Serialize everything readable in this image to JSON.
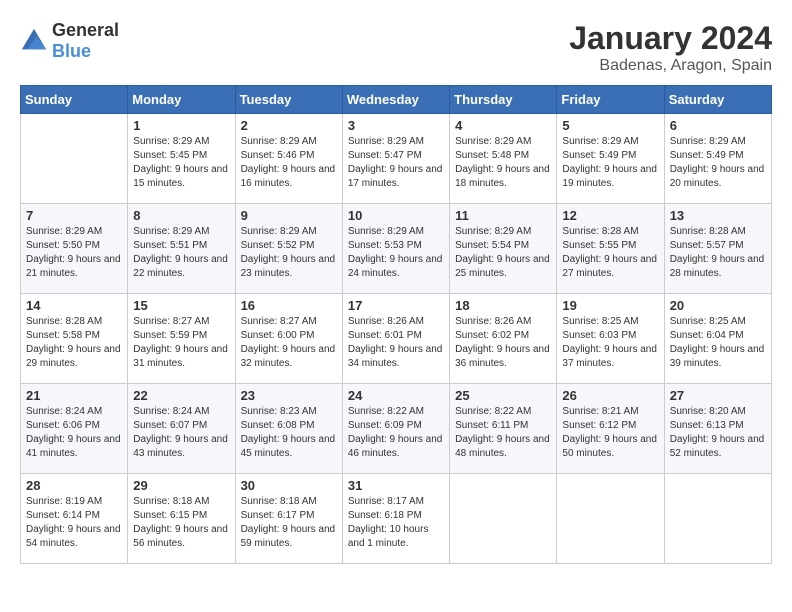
{
  "logo": {
    "general": "General",
    "blue": "Blue"
  },
  "title": "January 2024",
  "location": "Badenas, Aragon, Spain",
  "days_of_week": [
    "Sunday",
    "Monday",
    "Tuesday",
    "Wednesday",
    "Thursday",
    "Friday",
    "Saturday"
  ],
  "weeks": [
    [
      {
        "day": "",
        "sunrise": "",
        "sunset": "",
        "daylight": ""
      },
      {
        "day": "1",
        "sunrise": "Sunrise: 8:29 AM",
        "sunset": "Sunset: 5:45 PM",
        "daylight": "Daylight: 9 hours and 15 minutes."
      },
      {
        "day": "2",
        "sunrise": "Sunrise: 8:29 AM",
        "sunset": "Sunset: 5:46 PM",
        "daylight": "Daylight: 9 hours and 16 minutes."
      },
      {
        "day": "3",
        "sunrise": "Sunrise: 8:29 AM",
        "sunset": "Sunset: 5:47 PM",
        "daylight": "Daylight: 9 hours and 17 minutes."
      },
      {
        "day": "4",
        "sunrise": "Sunrise: 8:29 AM",
        "sunset": "Sunset: 5:48 PM",
        "daylight": "Daylight: 9 hours and 18 minutes."
      },
      {
        "day": "5",
        "sunrise": "Sunrise: 8:29 AM",
        "sunset": "Sunset: 5:49 PM",
        "daylight": "Daylight: 9 hours and 19 minutes."
      },
      {
        "day": "6",
        "sunrise": "Sunrise: 8:29 AM",
        "sunset": "Sunset: 5:49 PM",
        "daylight": "Daylight: 9 hours and 20 minutes."
      }
    ],
    [
      {
        "day": "7",
        "sunrise": "Sunrise: 8:29 AM",
        "sunset": "Sunset: 5:50 PM",
        "daylight": "Daylight: 9 hours and 21 minutes."
      },
      {
        "day": "8",
        "sunrise": "Sunrise: 8:29 AM",
        "sunset": "Sunset: 5:51 PM",
        "daylight": "Daylight: 9 hours and 22 minutes."
      },
      {
        "day": "9",
        "sunrise": "Sunrise: 8:29 AM",
        "sunset": "Sunset: 5:52 PM",
        "daylight": "Daylight: 9 hours and 23 minutes."
      },
      {
        "day": "10",
        "sunrise": "Sunrise: 8:29 AM",
        "sunset": "Sunset: 5:53 PM",
        "daylight": "Daylight: 9 hours and 24 minutes."
      },
      {
        "day": "11",
        "sunrise": "Sunrise: 8:29 AM",
        "sunset": "Sunset: 5:54 PM",
        "daylight": "Daylight: 9 hours and 25 minutes."
      },
      {
        "day": "12",
        "sunrise": "Sunrise: 8:28 AM",
        "sunset": "Sunset: 5:55 PM",
        "daylight": "Daylight: 9 hours and 27 minutes."
      },
      {
        "day": "13",
        "sunrise": "Sunrise: 8:28 AM",
        "sunset": "Sunset: 5:57 PM",
        "daylight": "Daylight: 9 hours and 28 minutes."
      }
    ],
    [
      {
        "day": "14",
        "sunrise": "Sunrise: 8:28 AM",
        "sunset": "Sunset: 5:58 PM",
        "daylight": "Daylight: 9 hours and 29 minutes."
      },
      {
        "day": "15",
        "sunrise": "Sunrise: 8:27 AM",
        "sunset": "Sunset: 5:59 PM",
        "daylight": "Daylight: 9 hours and 31 minutes."
      },
      {
        "day": "16",
        "sunrise": "Sunrise: 8:27 AM",
        "sunset": "Sunset: 6:00 PM",
        "daylight": "Daylight: 9 hours and 32 minutes."
      },
      {
        "day": "17",
        "sunrise": "Sunrise: 8:26 AM",
        "sunset": "Sunset: 6:01 PM",
        "daylight": "Daylight: 9 hours and 34 minutes."
      },
      {
        "day": "18",
        "sunrise": "Sunrise: 8:26 AM",
        "sunset": "Sunset: 6:02 PM",
        "daylight": "Daylight: 9 hours and 36 minutes."
      },
      {
        "day": "19",
        "sunrise": "Sunrise: 8:25 AM",
        "sunset": "Sunset: 6:03 PM",
        "daylight": "Daylight: 9 hours and 37 minutes."
      },
      {
        "day": "20",
        "sunrise": "Sunrise: 8:25 AM",
        "sunset": "Sunset: 6:04 PM",
        "daylight": "Daylight: 9 hours and 39 minutes."
      }
    ],
    [
      {
        "day": "21",
        "sunrise": "Sunrise: 8:24 AM",
        "sunset": "Sunset: 6:06 PM",
        "daylight": "Daylight: 9 hours and 41 minutes."
      },
      {
        "day": "22",
        "sunrise": "Sunrise: 8:24 AM",
        "sunset": "Sunset: 6:07 PM",
        "daylight": "Daylight: 9 hours and 43 minutes."
      },
      {
        "day": "23",
        "sunrise": "Sunrise: 8:23 AM",
        "sunset": "Sunset: 6:08 PM",
        "daylight": "Daylight: 9 hours and 45 minutes."
      },
      {
        "day": "24",
        "sunrise": "Sunrise: 8:22 AM",
        "sunset": "Sunset: 6:09 PM",
        "daylight": "Daylight: 9 hours and 46 minutes."
      },
      {
        "day": "25",
        "sunrise": "Sunrise: 8:22 AM",
        "sunset": "Sunset: 6:11 PM",
        "daylight": "Daylight: 9 hours and 48 minutes."
      },
      {
        "day": "26",
        "sunrise": "Sunrise: 8:21 AM",
        "sunset": "Sunset: 6:12 PM",
        "daylight": "Daylight: 9 hours and 50 minutes."
      },
      {
        "day": "27",
        "sunrise": "Sunrise: 8:20 AM",
        "sunset": "Sunset: 6:13 PM",
        "daylight": "Daylight: 9 hours and 52 minutes."
      }
    ],
    [
      {
        "day": "28",
        "sunrise": "Sunrise: 8:19 AM",
        "sunset": "Sunset: 6:14 PM",
        "daylight": "Daylight: 9 hours and 54 minutes."
      },
      {
        "day": "29",
        "sunrise": "Sunrise: 8:18 AM",
        "sunset": "Sunset: 6:15 PM",
        "daylight": "Daylight: 9 hours and 56 minutes."
      },
      {
        "day": "30",
        "sunrise": "Sunrise: 8:18 AM",
        "sunset": "Sunset: 6:17 PM",
        "daylight": "Daylight: 9 hours and 59 minutes."
      },
      {
        "day": "31",
        "sunrise": "Sunrise: 8:17 AM",
        "sunset": "Sunset: 6:18 PM",
        "daylight": "Daylight: 10 hours and 1 minute."
      },
      {
        "day": "",
        "sunrise": "",
        "sunset": "",
        "daylight": ""
      },
      {
        "day": "",
        "sunrise": "",
        "sunset": "",
        "daylight": ""
      },
      {
        "day": "",
        "sunrise": "",
        "sunset": "",
        "daylight": ""
      }
    ]
  ]
}
